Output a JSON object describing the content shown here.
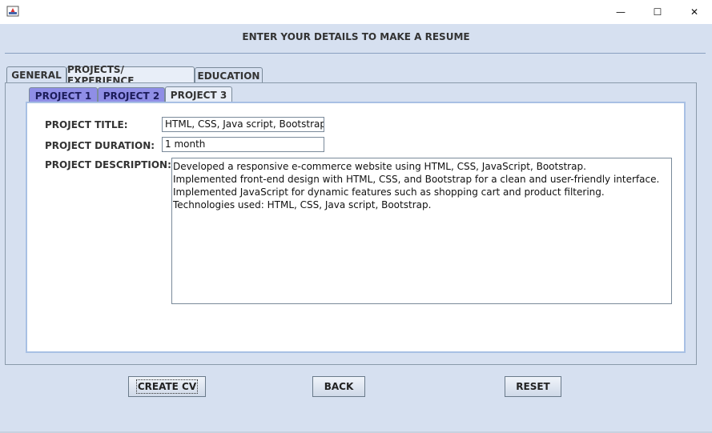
{
  "window": {
    "minimize_glyph": "—",
    "maximize_glyph": "☐",
    "close_glyph": "✕"
  },
  "heading": "ENTER YOUR DETAILS TO MAKE A RESUME",
  "tabs": [
    {
      "label": "GENERAL"
    },
    {
      "label": "PROJECTS/ EXPERIENCE"
    },
    {
      "label": "EDUCATION"
    }
  ],
  "subtabs": [
    {
      "label": "PROJECT 1"
    },
    {
      "label": "PROJECT 2"
    },
    {
      "label": "PROJECT 3"
    }
  ],
  "form": {
    "title_label": "PROJECT TITLE:",
    "title_value": "HTML, CSS, Java script, Bootstrap.",
    "duration_label": "PROJECT DURATION:",
    "duration_value": "1 month",
    "description_label": "PROJECT DESCRIPTION:",
    "description_lines": [
      "Developed a responsive e-commerce website using HTML, CSS, JavaScript, Bootstrap.",
      "Implemented front-end design with HTML, CSS, and Bootstrap for a clean and user-friendly interface.",
      "Implemented JavaScript for dynamic features such as shopping cart and product filtering.",
      "Technologies used: HTML, CSS, Java script, Bootstrap."
    ]
  },
  "buttons": {
    "create": "CREATE CV",
    "back": "BACK",
    "reset": "RESET"
  },
  "colors": {
    "background": "#d6e0f0",
    "unselected_subtab": "#8f8ee6",
    "panel_border": "#a8c0e4"
  }
}
